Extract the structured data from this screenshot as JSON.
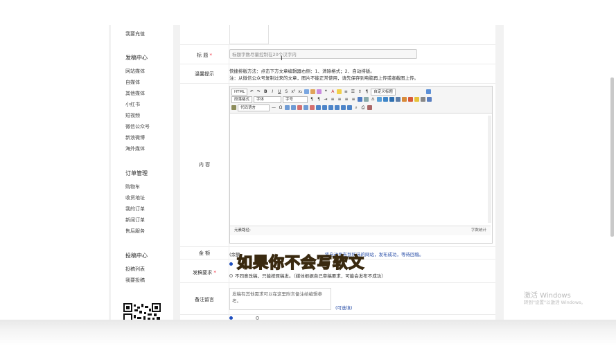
{
  "sidebar": {
    "top_item": "我要充值",
    "sections": [
      {
        "title": "发稿中心",
        "items": [
          "网站媒体",
          "自媒体",
          "其他媒体",
          "小红书",
          "短视频",
          "微信公众号",
          "新浪微博",
          "海外媒体"
        ]
      },
      {
        "title": "订单管理",
        "items": [
          "购物车",
          "收货地址",
          "我的订单",
          "新闻订单",
          "售后服务"
        ]
      },
      {
        "title": "投稿中心",
        "items": [
          "投稿列表",
          "我要投稿"
        ]
      }
    ]
  },
  "form": {
    "title_label": "标 题",
    "required_mark": "*",
    "title_placeholder": "标题字数尽量控制在20个汉字内",
    "tips_label": "温馨提示",
    "tip_line1": "快捷排版方法：点击下方文章编辑器右侧：1、清除格式；2、自动排版。",
    "tip_line2": "注：从微信公众号复制过来的文章，图片不能正常使用，请先保存到电脑再上传或者截图上传。",
    "content_label": "内 容",
    "toolbar": {
      "html_label": "HTML",
      "custom_title": "自定义标题",
      "para_format": "段落格式",
      "font_family": "字体",
      "font_size": "字号",
      "code_lang": "代码语言"
    },
    "element_path_label": "元素路径:",
    "word_count_label": "字数统计",
    "amount_label": "金 额",
    "amount_prefix": "(余额",
    "amount_link": "将自动发布到所选的网站，发布成功，等待回稿。",
    "requirement_label": "发稿要求",
    "option1": "",
    "option2": "不同意改稿，只能按原稿发。（媒体根据自己审稿要求，可能会发布不成功）",
    "remarks_label": "备注留言",
    "remarks_placeholder": "发稿有其他需求可以在这里附言备注给编辑参考。",
    "optional_hint": "(可选填)"
  },
  "overlay": {
    "subtitle": "如果你不会写软文",
    "win_watermark_title": "激活 Windows",
    "win_watermark_sub": "转到\"设置\"以激活 Windows。"
  }
}
